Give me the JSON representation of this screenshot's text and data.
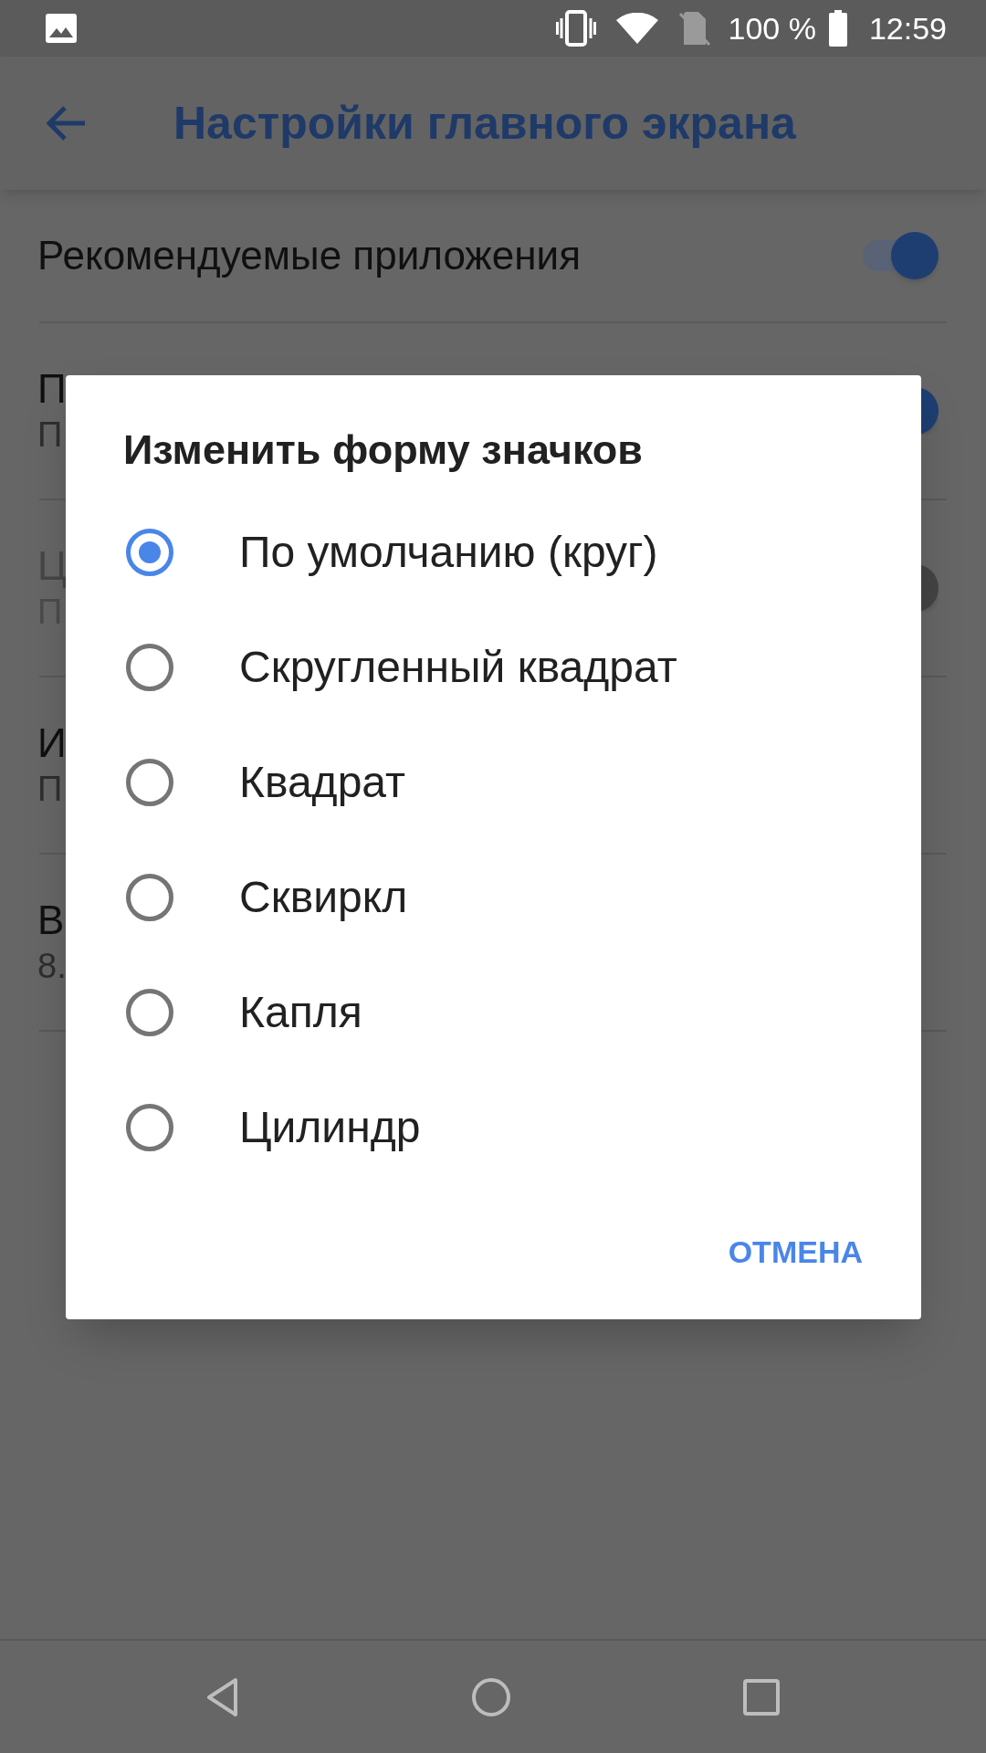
{
  "status_bar": {
    "battery": "100 %",
    "time": "12:59"
  },
  "app_bar": {
    "title": "Настройки главного экрана"
  },
  "settings": [
    {
      "kind": "switch",
      "title": "Рекомендуемые приложения",
      "on": true,
      "disabled": false
    },
    {
      "kind": "switch",
      "title": "П",
      "subtitle": "П",
      "on": true,
      "disabled": false
    },
    {
      "kind": "switch",
      "title": "Ц",
      "subtitle": "П",
      "on": true,
      "disabled": true
    },
    {
      "kind": "text",
      "title": "И",
      "subtitle": "П",
      "disabled": false
    },
    {
      "kind": "text",
      "title": "В",
      "subtitle": "8.",
      "disabled": false
    }
  ],
  "dialog": {
    "title": "Изменить форму значков",
    "options": [
      {
        "label": "По умолчанию (круг)",
        "selected": true
      },
      {
        "label": "Скругленный квадрат",
        "selected": false
      },
      {
        "label": "Квадрат",
        "selected": false
      },
      {
        "label": "Сквиркл",
        "selected": false
      },
      {
        "label": "Капля",
        "selected": false
      },
      {
        "label": "Цилиндр",
        "selected": false
      }
    ],
    "buttons": [
      "ОТМЕНА"
    ]
  }
}
